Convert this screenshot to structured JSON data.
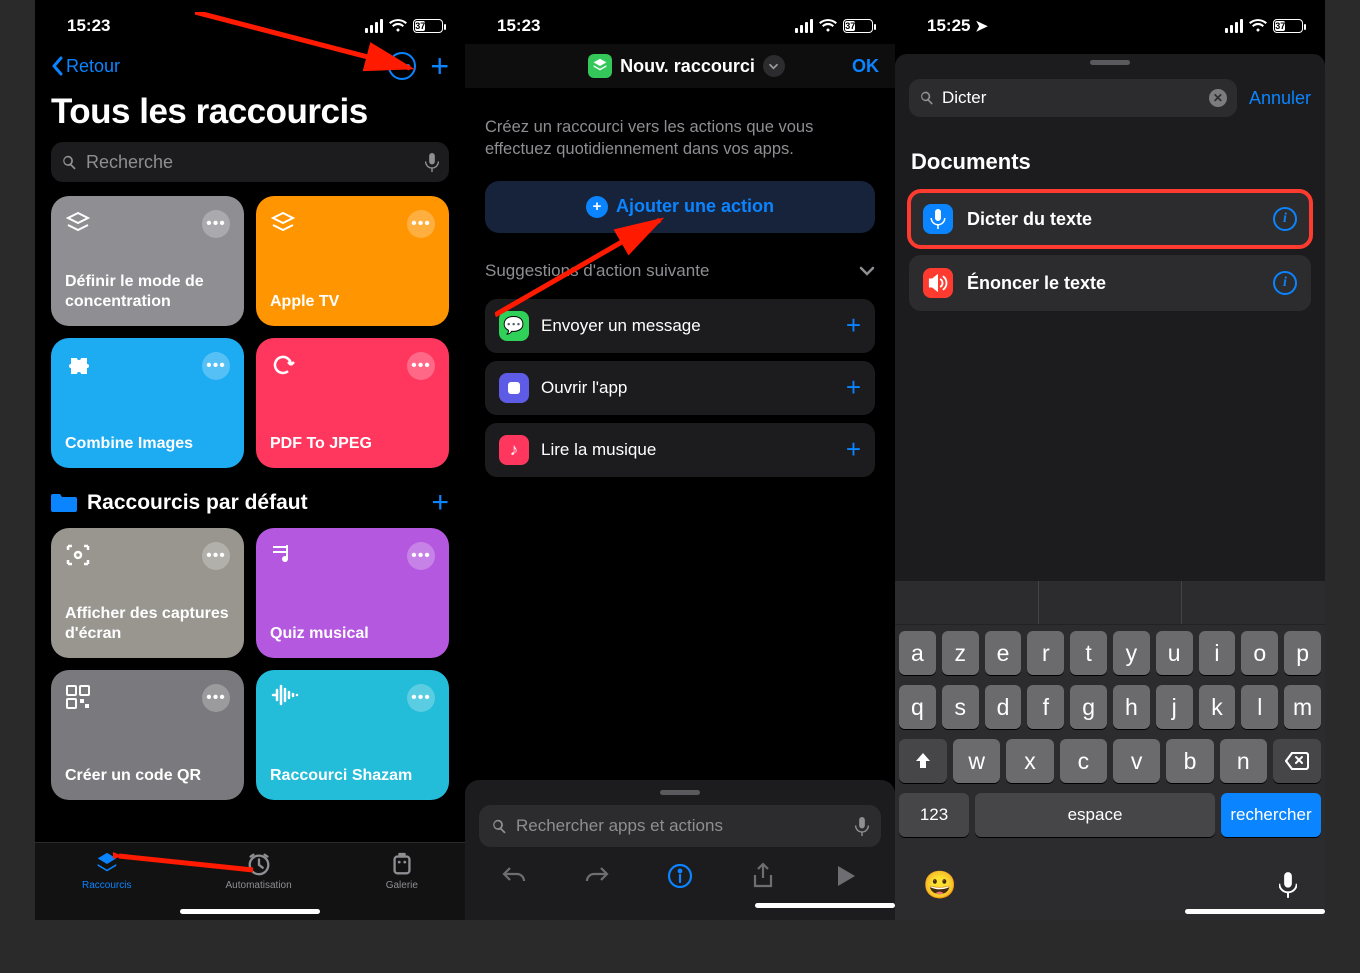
{
  "statusBar": {
    "time1": "15:23",
    "time2": "15:23",
    "time3": "15:25",
    "battery": "37"
  },
  "phone1": {
    "back": "Retour",
    "title": "Tous les raccourcis",
    "searchPlaceholder": "Recherche",
    "cards": [
      {
        "label": "Définir le mode de concentration",
        "color": "#8e8e93",
        "icon": "layers"
      },
      {
        "label": "Apple TV",
        "color": "#ff9500",
        "icon": "layers"
      },
      {
        "label": "Combine Images",
        "color": "#1dabf2",
        "icon": "puzzle"
      },
      {
        "label": "PDF To JPEG",
        "color": "#ff375f",
        "icon": "cycle"
      }
    ],
    "sectionTitle": "Raccourcis par défaut",
    "cards2": [
      {
        "label": "Afficher des captures d'écran",
        "color": "#99968f",
        "icon": "camera"
      },
      {
        "label": "Quiz musical",
        "color": "#b558e0",
        "icon": "music"
      },
      {
        "label": "Créer un code QR",
        "color": "#7a7a7e",
        "icon": "qr"
      },
      {
        "label": "Raccourci Shazam",
        "color": "#23bcd9",
        "icon": "wave"
      }
    ],
    "tabs": {
      "shortcuts": "Raccourcis",
      "automation": "Automatisation",
      "gallery": "Galerie"
    }
  },
  "phone2": {
    "navTitle": "Nouv. raccourci",
    "ok": "OK",
    "intro": "Créez un raccourci vers les actions que vous effectuez quotidiennement dans vos apps.",
    "addAction": "Ajouter une action",
    "suggHeader": "Suggestions d'action suivante",
    "actions": [
      {
        "label": "Envoyer un message",
        "color": "#30d158",
        "glyph": "💬"
      },
      {
        "label": "Ouvrir l'app",
        "color": "#5e5ce6",
        "glyph": "▢"
      },
      {
        "label": "Lire la musique",
        "color": "#ff375f",
        "glyph": "♪"
      }
    ],
    "sheetSearch": "Rechercher apps et actions"
  },
  "phone3": {
    "searchValue": "Dicter",
    "cancel": "Annuler",
    "sectionTitle": "Documents",
    "results": [
      {
        "label": "Dicter du texte",
        "color": "#0a84ff",
        "glyph": "mic",
        "highlight": true
      },
      {
        "label": "Énoncer le texte",
        "color": "#ff3b30",
        "glyph": "speaker",
        "highlight": false
      }
    ],
    "keyboard": {
      "row1": [
        "a",
        "z",
        "e",
        "r",
        "t",
        "y",
        "u",
        "i",
        "o",
        "p"
      ],
      "row2": [
        "q",
        "s",
        "d",
        "f",
        "g",
        "h",
        "j",
        "k",
        "l",
        "m"
      ],
      "row3": [
        "w",
        "x",
        "c",
        "v",
        "b",
        "n"
      ],
      "numKey": "123",
      "space": "espace",
      "search": "rechercher"
    }
  }
}
